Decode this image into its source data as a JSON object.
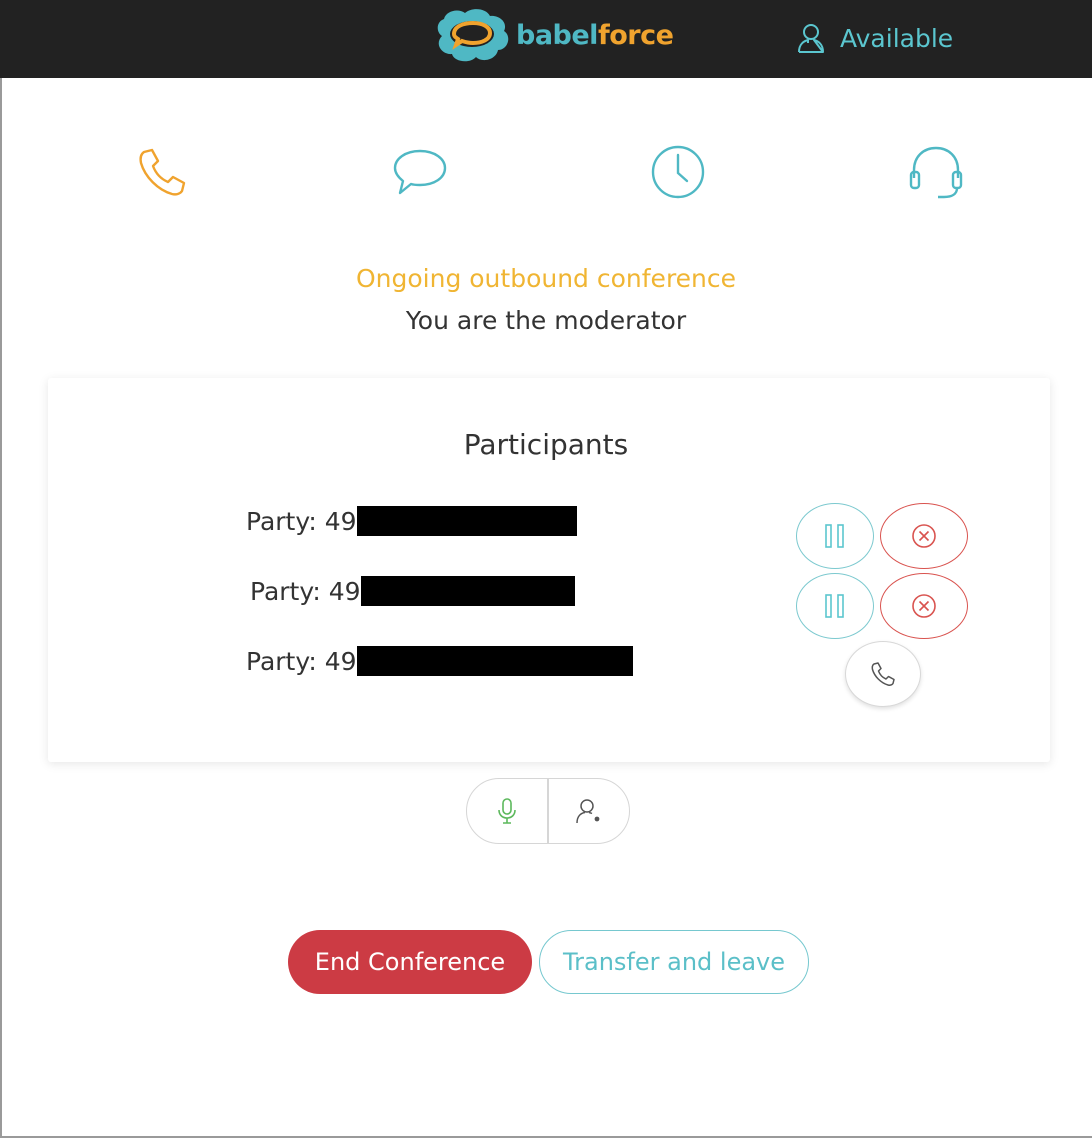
{
  "header": {
    "logo_part1": "babel",
    "logo_part2": "force",
    "status_label": "Available"
  },
  "tabs": [
    {
      "name": "phone",
      "icon": "phone-icon",
      "active": true
    },
    {
      "name": "chat",
      "icon": "chat-icon",
      "active": false
    },
    {
      "name": "history",
      "icon": "clock-icon",
      "active": false
    },
    {
      "name": "agents",
      "icon": "headset-icon",
      "active": false
    }
  ],
  "call": {
    "status": "Ongoing outbound conference",
    "role": "You are the moderator"
  },
  "participants": {
    "title": "Participants",
    "parties": [
      {
        "label": "Party: 49"
      },
      {
        "label": "Party: 49"
      },
      {
        "label": "Party: 49"
      }
    ]
  },
  "actions": {
    "end_label": "End Conference",
    "transfer_label": "Transfer and leave"
  },
  "colors": {
    "accent_teal": "#5bc6cf",
    "accent_orange": "#f0a32e",
    "status_yellow": "#f0b533",
    "danger_red": "#cc3b44",
    "header_bg": "#222222"
  }
}
